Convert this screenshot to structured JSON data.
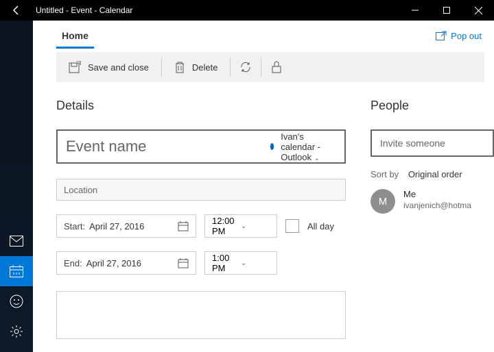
{
  "window": {
    "title": "Untitled - Event - Calendar"
  },
  "tabs": {
    "home": "Home"
  },
  "popout": "Pop out",
  "toolbar": {
    "saveClose": "Save and close",
    "delete": "Delete"
  },
  "details": {
    "heading": "Details",
    "eventNamePlaceholder": "Event name",
    "calendarLabel": "Ivan's calendar - Outlook",
    "locationPlaceholder": "Location",
    "startLabel": "Start:",
    "startDate": "April 27, 2016",
    "startTime": "12:00 PM",
    "endLabel": "End:",
    "endDate": "April 27, 2016",
    "endTime": "1:00 PM",
    "allDay": "All day"
  },
  "people": {
    "heading": "People",
    "invitePlaceholder": "Invite someone",
    "sortBy": "Sort by",
    "sortOrder": "Original order",
    "me": {
      "initial": "M",
      "name": "Me",
      "email": "ivanjenich@hotma"
    }
  }
}
